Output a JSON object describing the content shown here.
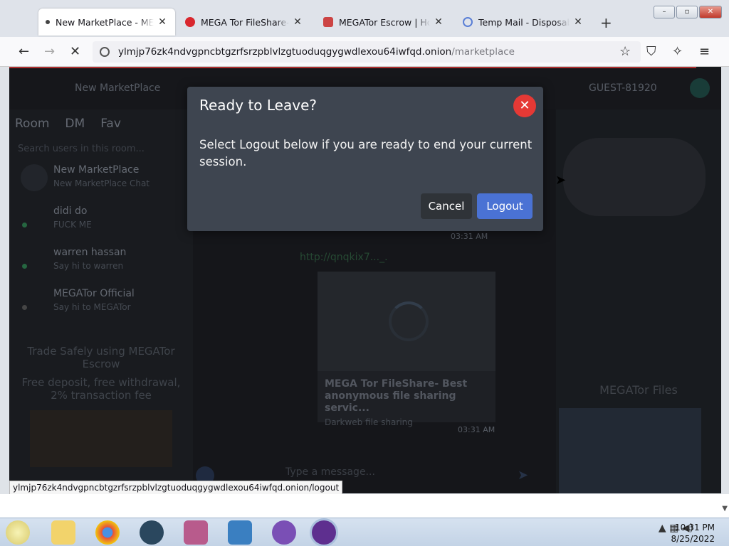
{
  "browser": {
    "tabs": [
      {
        "title": "New MarketPlace - MEGATor",
        "icon": "dot-icon",
        "active": true
      },
      {
        "title": "MEGA Tor FileShare- Best anonymous",
        "icon": "mega-icon"
      },
      {
        "title": "MEGATor Escrow | Home",
        "icon": "escrow-icon"
      },
      {
        "title": "Temp Mail - Disposable Temporary",
        "icon": "at-icon"
      }
    ],
    "close_glyph": "✕",
    "new_tab": "+",
    "url_host": "ylmjp76zk4ndvgpncbtgzrfsrzpblvlzgtuoduqgygwdlexou64iwfqd.onion",
    "url_path": "/marketplace",
    "status_url": "ylmjp76zk4ndvgpncbtgzrfsrzpblvlzgtuoduqgygwdlexou64iwfqd.onion/logout"
  },
  "page": {
    "site_name": "New MarketPlace",
    "user": "GUEST-81920",
    "sidebar_tabs": [
      "Room",
      "DM",
      "Fav"
    ],
    "search_placeholder": "Search users in this room...",
    "chats": [
      {
        "name": "New MarketPlace",
        "sub": "New MarketPlace Chat"
      },
      {
        "name": "didi do",
        "sub": "FUCK ME"
      },
      {
        "name": "warren hassan",
        "sub": "Say hi to warren"
      },
      {
        "name": "MEGATor Official",
        "sub": "Say hi to MEGATor"
      }
    ],
    "promo_title": "Trade Safely using MEGATor Escrow",
    "promo_sub": "Free deposit, free withdrawal, 2% transaction fee",
    "link": "http://qnqkix7..._.",
    "time1": "03:31 AM",
    "time2": "03:31 AM",
    "card_title": "MEGA Tor FileShare- Best anonymous file sharing servic...",
    "card_sub": "Darkweb file sharing",
    "message_placeholder": "Type a message...",
    "right_title": "MEGATor Files"
  },
  "modal": {
    "title": "Ready to Leave?",
    "body": "Select Logout below if you are ready to end your current session.",
    "cancel": "Cancel",
    "logout": "Logout",
    "close_glyph": "✕"
  },
  "taskbar": {
    "time": "10:31 PM",
    "date": "8/25/2022"
  },
  "colors": {
    "logout_button": "#4a72d4",
    "close_button": "#e53935",
    "modal_bg": "#3e4550"
  }
}
